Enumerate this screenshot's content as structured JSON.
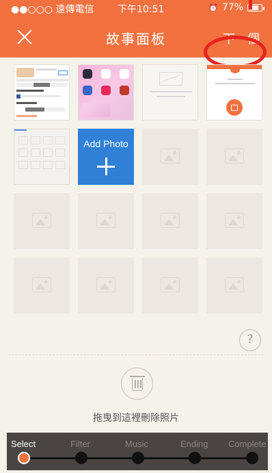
{
  "status_bar": {
    "carrier": "●●○○○ 遠傳電信",
    "time": "下午10:51",
    "battery": "77%",
    "battery_level": 0.77
  },
  "nav": {
    "title": "故事面板",
    "next_label": "下一個"
  },
  "grid": {
    "add_photo_label": "Add Photo"
  },
  "help_label": "?",
  "trash": {
    "label": "拖曳到這裡刪除照片"
  },
  "steps": {
    "items": [
      {
        "label": "Select",
        "active": true
      },
      {
        "label": "Filter",
        "active": false
      },
      {
        "label": "Music",
        "active": false
      },
      {
        "label": "Ending",
        "active": false
      },
      {
        "label": "Complete",
        "active": false
      }
    ]
  },
  "colors": {
    "accent": "#f2713f",
    "add_tile": "#2f80d6",
    "annotation": "#e8231e"
  }
}
